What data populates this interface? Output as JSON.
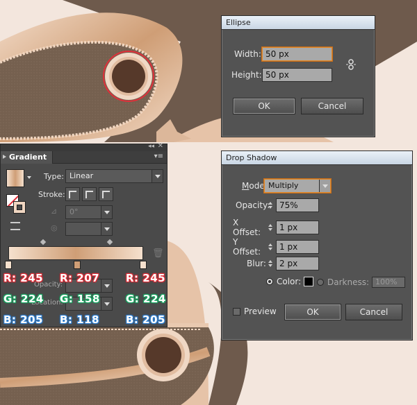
{
  "ellipse_dialog": {
    "title": "Ellipse",
    "width_label": "Width:",
    "width_value": "50 px",
    "height_label": "Height:",
    "height_value": "50 px",
    "ok_label": "OK",
    "cancel_label": "Cancel"
  },
  "gradient_panel": {
    "tab_label": "Gradient",
    "type_label": "Type:",
    "type_value": "Linear",
    "stroke_label": "Stroke:",
    "angle_value": "0°",
    "opacity_label": "Opacity:",
    "location_label": "Location:",
    "stops": [
      {
        "r": "R: 245",
        "g": "G: 224",
        "b": "B: 205",
        "color": "#f5e0cd"
      },
      {
        "r": "R: 207",
        "g": "G: 158",
        "b": "B: 118",
        "color": "#cf9e76"
      },
      {
        "r": "R: 245",
        "g": "G: 224",
        "b": "B: 205",
        "color": "#f5e0cd"
      }
    ]
  },
  "drop_shadow_dialog": {
    "title": "Drop Shadow",
    "mode_label": "Mode:",
    "mode_value": "Multiply",
    "opacity_label": "Opacity:",
    "opacity_value": "75%",
    "x_offset_label": "X Offset:",
    "x_offset_value": "1 px",
    "y_offset_label": "Y Offset:",
    "y_offset_value": "1 px",
    "blur_label": "Blur:",
    "blur_value": "2 px",
    "color_label": "Color:",
    "color_value": "#000000",
    "darkness_label": "Darkness:",
    "darkness_value": "100%",
    "preview_label": "Preview",
    "ok_label": "OK",
    "cancel_label": "Cancel"
  },
  "colors": {
    "background": "#f3e6dd",
    "leather_light": "#e5c4aa",
    "leather_dark": "#6e5a4c",
    "eyelet_hole": "#56392a",
    "highlight_circle": "#e0303a"
  }
}
